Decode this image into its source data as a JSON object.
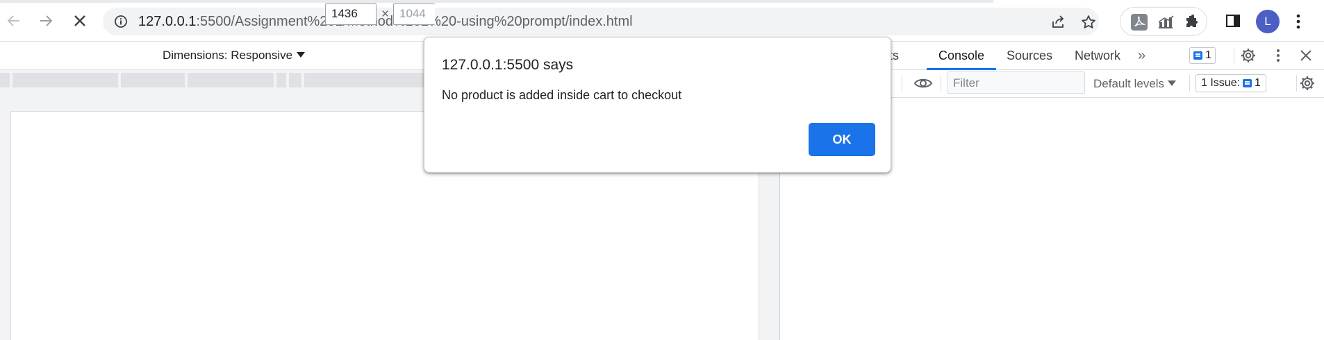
{
  "browser": {
    "url_host": "127.0.0.1",
    "url_rest": ":5500/Assignment%201/Method%202%20-using%20prompt/index.html",
    "avatar_letter": "L"
  },
  "device_toolbar": {
    "dimensions_label": "Dimensions: Responsive",
    "width_value": "1436",
    "times": "×",
    "height_value": "1044"
  },
  "devtools": {
    "tabs": [
      {
        "label": "ents"
      },
      {
        "label": "Console"
      },
      {
        "label": "Sources"
      },
      {
        "label": "Network"
      }
    ],
    "more_tabs": "»",
    "message_count": "1",
    "filter_placeholder": "Filter",
    "levels_label": "Default levels",
    "issues_label": "1 Issue:",
    "issues_count": "1"
  },
  "dialog": {
    "title": "127.0.0.1:5500 says",
    "message": "No product is added inside cart to checkout",
    "ok_label": "OK"
  },
  "colors": {
    "accent": "#1a73e8",
    "avatar": "#4b5fc4"
  }
}
